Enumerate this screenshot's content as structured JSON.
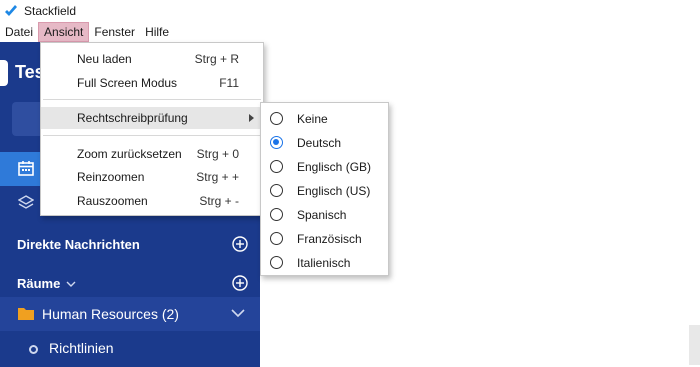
{
  "window": {
    "title": "Stackfield",
    "logo_icon": "stackfield-logo-icon"
  },
  "menubar": {
    "items": [
      {
        "label": "Datei"
      },
      {
        "label": "Ansicht",
        "active": true
      },
      {
        "label": "Fenster"
      },
      {
        "label": "Hilfe"
      }
    ]
  },
  "dropdown": {
    "items": [
      {
        "label": "Neu laden",
        "shortcut": "Strg + R"
      },
      {
        "label": "Full Screen Modus",
        "shortcut": "F11"
      },
      {
        "label": "Rechtschreibprüfung",
        "has_submenu": true
      },
      {
        "label": "Zoom zurücksetzen",
        "shortcut": "Strg + 0"
      },
      {
        "label": "Reinzoomen",
        "shortcut": "Strg + +"
      },
      {
        "label": "Rauszoomen",
        "shortcut": "Strg + -"
      }
    ]
  },
  "spellcheck_submenu": {
    "selected": "Deutsch",
    "options": [
      "Keine",
      "Deutsch",
      "Englisch (GB)",
      "Englisch (US)",
      "Spanisch",
      "Französisch",
      "Italienisch"
    ]
  },
  "sidebar": {
    "workspace_name": "Tes",
    "sections": {
      "direct_messages": "Direkte Nachrichten",
      "rooms": "Räume"
    },
    "room": {
      "label": "Human Resources (2)"
    },
    "subroom": {
      "label": "Richtlinien"
    }
  },
  "colors": {
    "sidebar_bg": "#1b3a8c",
    "accent": "#2f7ad9",
    "menu_active": "#e6b9c6",
    "radio_checked": "#1a73e8",
    "folder": "#f0a020"
  }
}
